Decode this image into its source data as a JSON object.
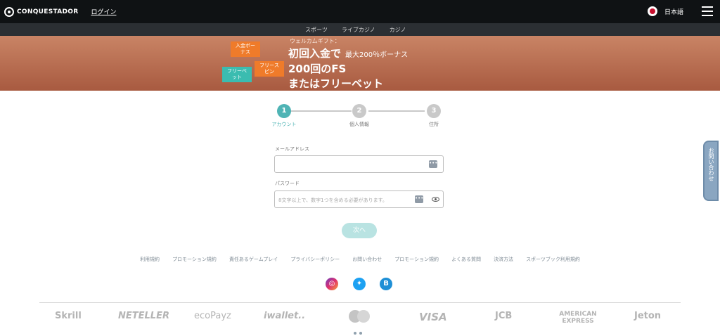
{
  "header": {
    "logo_text": "CONQUESTADOR",
    "login_label": "ログイン",
    "language_label": "日本語"
  },
  "nav": {
    "tabs": [
      {
        "label": "スポーツ"
      },
      {
        "label": "ライブカジノ"
      },
      {
        "label": "カジノ",
        "active": true
      }
    ]
  },
  "banner": {
    "tag_deposit_bonus": "入金ボーナス",
    "tag_freebet": "フリーベット",
    "tag_freespin": "フリースピン",
    "welcome": "ウェルカムギフト：",
    "line1_main": "初回入金で",
    "line1_small": "最大200％ボーナス",
    "line2": "200回のFS",
    "line3": "またはフリーベット"
  },
  "steps": [
    {
      "number": "1",
      "label": "アカウント",
      "active": true
    },
    {
      "number": "2",
      "label": "個人情報",
      "active": false
    },
    {
      "number": "3",
      "label": "住所",
      "active": false
    }
  ],
  "form": {
    "email_label": "メールアドレス",
    "email_value": "",
    "password_label": "パスワード",
    "password_placeholder": "8文字以上で、数字1つを含める必要があります。",
    "next_label": "次へ"
  },
  "footer": {
    "links": [
      "利用規約",
      "プロモーション規約",
      "責任あるゲームプレイ",
      "プライバシーポリシー",
      "お問い合わせ",
      "プロモーション規約",
      "よくある質問",
      "決済方法",
      "スポーツブック利用規約"
    ],
    "social": [
      "instagram-icon",
      "twitter-icon",
      "b-icon"
    ],
    "payments": [
      "Skrill",
      "NETELLER",
      "ecoPayz",
      "iwallet..",
      "VISA",
      "JCB",
      "AMERICAN EXPRESS",
      "Jeton"
    ]
  },
  "contact_tab": "お問い合わせ",
  "colors": {
    "accent": "#4fb4b5",
    "banner": "#b86e52",
    "topbar": "#0f1214"
  }
}
